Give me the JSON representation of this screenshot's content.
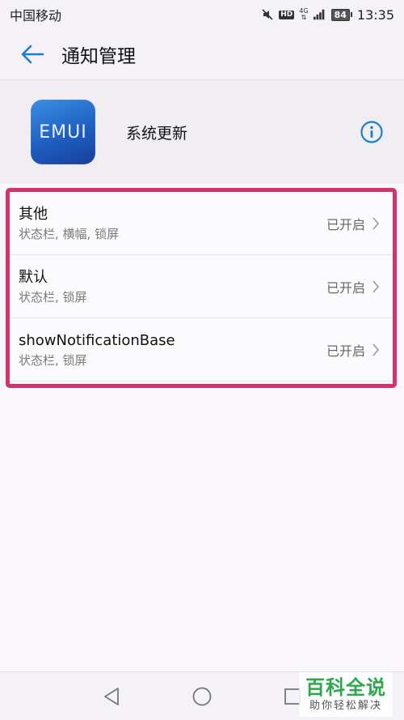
{
  "status_bar": {
    "carrier": "中国移动",
    "network_hd": "HD",
    "network_type": "4G",
    "battery": "84",
    "time": "13:35"
  },
  "header": {
    "title": "通知管理"
  },
  "app": {
    "icon_text": "EMUI",
    "name": "系统更新"
  },
  "items": [
    {
      "title": "其他",
      "subtitle": "状态栏, 横幅, 锁屏",
      "status": "已开启"
    },
    {
      "title": "默认",
      "subtitle": "状态栏, 锁屏",
      "status": "已开启"
    },
    {
      "title": "showNotificationBase",
      "subtitle": "状态栏, 锁屏",
      "status": "已开启"
    }
  ],
  "watermark": {
    "title": "百科全说",
    "subtitle": "助你轻松解决"
  },
  "colors": {
    "accent": "#1a7fd4",
    "highlight_border": "#d0336f"
  }
}
